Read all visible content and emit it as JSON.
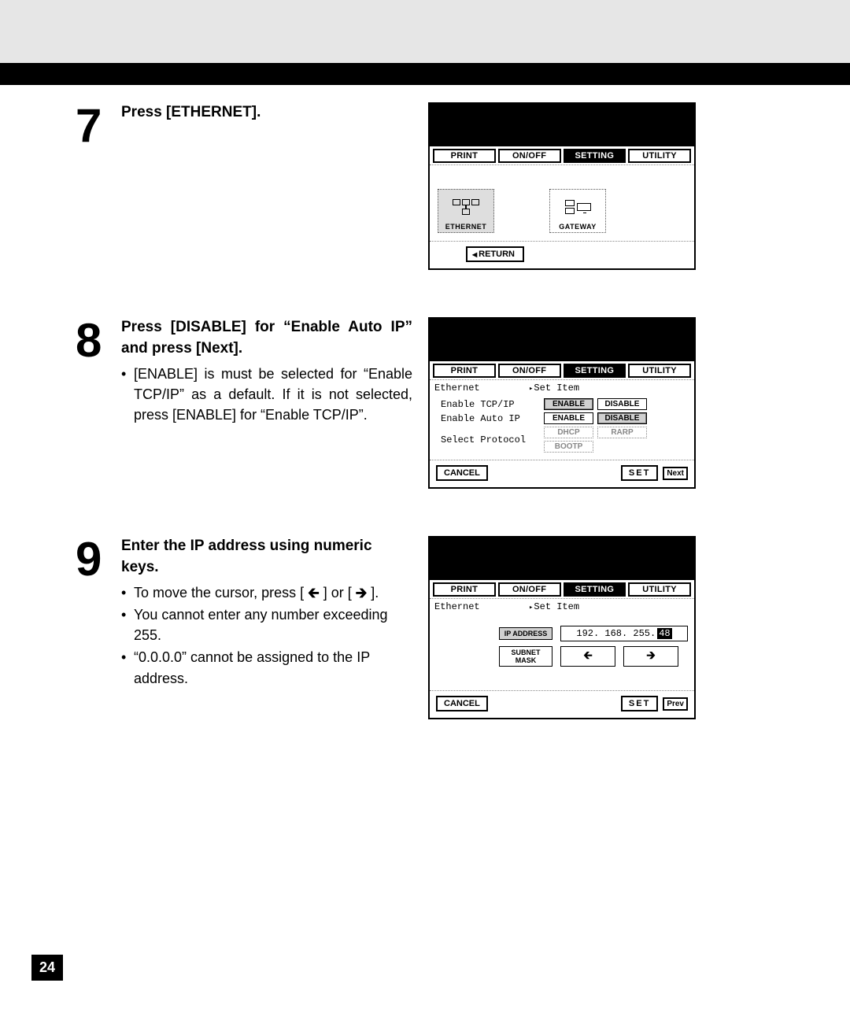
{
  "page_number": "24",
  "tabs": {
    "print": "PRINT",
    "onoff": "ON/OFF",
    "setting": "SETTING",
    "utility": "UTILITY"
  },
  "common": {
    "return": "RETURN",
    "cancel": "CANCEL",
    "set": "SET",
    "next": "Next",
    "prev": "Prev"
  },
  "step7": {
    "num": "7",
    "title": "Press [ETHERNET].",
    "screen": {
      "ethernet": "ETHERNET",
      "gateway": "GATEWAY"
    }
  },
  "step8": {
    "num": "8",
    "title": "Press [DISABLE] for “Enable Auto IP” and press [Next].",
    "bullet1": "[ENABLE] is must be selected for “Enable TCP/IP” as a default.  If it is not selected, press [ENABLE] for “Enable TCP/IP”.",
    "screen": {
      "breadcrumb_left": "Ethernet",
      "breadcrumb_right": "Set Item",
      "row1": "Enable TCP/IP",
      "row2": "Enable Auto IP",
      "row3": "Select Protocol",
      "enable": "ENABLE",
      "disable": "DISABLE",
      "dhcp": "DHCP",
      "rarp": "RARP",
      "bootp": "BOOTP"
    }
  },
  "step9": {
    "num": "9",
    "title": "Enter the IP address using numeric keys.",
    "bullet1_pre": "To move the cursor, press [ ",
    "bullet1_mid": " ] or [ ",
    "bullet1_post": " ].",
    "bullet2": "You cannot enter any number exceeding 255.",
    "bullet3": "“0.0.0.0” cannot be assigned to the IP address.",
    "screen": {
      "breadcrumb_left": "Ethernet",
      "breadcrumb_right": "Set Item",
      "ipaddress_label": "IP ADDRESS",
      "subnet_label": "SUBNET MASK",
      "ip_prefix": "192. 168. 255. ",
      "ip_cursor": "48",
      "arrow_left": "←",
      "arrow_right": "→"
    }
  }
}
